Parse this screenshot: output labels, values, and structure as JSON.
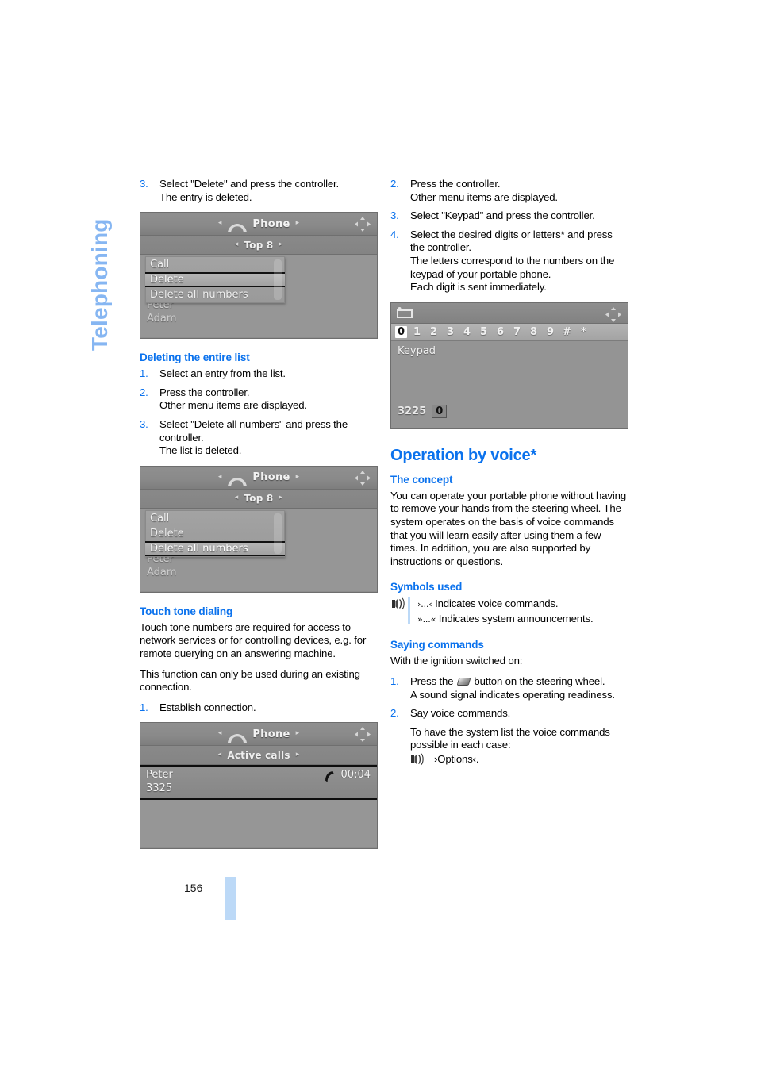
{
  "side_tab": {
    "label": "Telephoning",
    "color": "#86b6f2"
  },
  "folio": {
    "page_number": "156"
  },
  "colors": {
    "heading_blue": "#0b72ed",
    "tab_blue": "#86b6f2",
    "accent_bar": "#bcd9f7"
  },
  "left_column": {
    "step3_delete": {
      "num": "3.",
      "line1": "Select \"Delete\" and press the controller.",
      "line2": "The entry is deleted."
    },
    "screen_delete": {
      "header_title": "Phone",
      "subheader": "Top 8",
      "arrow_left": "◂",
      "arrow_right": "▸",
      "menu_items": [
        "Call",
        "Delete",
        "Delete all numbers"
      ],
      "selected_item": "Delete",
      "background_entries": [
        "Peter",
        "Adam"
      ]
    },
    "deleting_entire_list": {
      "heading": "Deleting the entire list",
      "steps": [
        {
          "num": "1.",
          "line1": "Select an entry from the list.",
          "line2": ""
        },
        {
          "num": "2.",
          "line1": "Press the controller.",
          "line2": "Other menu items are displayed."
        },
        {
          "num": "3.",
          "line1": "Select \"Delete all numbers\" and press the controller.",
          "line2": "The list is deleted."
        }
      ]
    },
    "screen_delete_all": {
      "header_title": "Phone",
      "subheader": "Top 8",
      "menu_items": [
        "Call",
        "Delete",
        "Delete all numbers"
      ],
      "selected_item": "Delete all numbers",
      "background_entries": [
        "Peter",
        "Adam"
      ]
    },
    "touch_tone": {
      "heading": "Touch tone dialing",
      "para1": "Touch tone numbers are required for access to network services or for controlling devices, e.g. for remote querying on an answering machine.",
      "para2": "This function can only be used during an existing connection.",
      "step1": {
        "num": "1.",
        "line1": "Establish connection."
      }
    },
    "screen_active_call": {
      "header_title": "Phone",
      "subheader": "Active calls",
      "caller_name": "Peter",
      "caller_number": "3325",
      "duration": "00:04"
    }
  },
  "right_column": {
    "steps_keypad": [
      {
        "num": "2.",
        "line1": "Press the controller.",
        "line2": "Other menu items are displayed."
      },
      {
        "num": "3.",
        "line1": "Select \"Keypad\" and press the controller.",
        "line2": ""
      },
      {
        "num": "4.",
        "line1": "Select the desired digits or letters* and press the controller.",
        "line2": "The letters correspond to the numbers on the keypad of your portable phone.",
        "line3": "Each digit is sent immediately."
      }
    ],
    "screen_keypad": {
      "keys": [
        "0",
        "1",
        "2",
        "3",
        "4",
        "5",
        "6",
        "7",
        "8",
        "9",
        "#",
        "*"
      ],
      "selected_key": "0",
      "label": "Keypad",
      "entry": "3225",
      "entry_cursor": "0"
    },
    "operation_by_voice": {
      "heading": "Operation by voice*",
      "concept_heading": "The concept",
      "concept_text": "You can operate your portable phone without having to remove your hands from the steering wheel. The system operates on the basis of voice commands that you will learn easily after using them a few times. In addition, you are also supported by instructions or questions.",
      "symbols_heading": "Symbols used",
      "symbol_voice_commands": {
        "marks": "›...‹",
        "text": "Indicates voice commands."
      },
      "symbol_system_announcements": {
        "marks": "»...«",
        "text": "Indicates system announcements."
      },
      "saying_heading": "Saying commands",
      "saying_intro": "With the ignition switched on:",
      "saying_steps": [
        {
          "num": "1.",
          "pre": "Press the",
          "post": "button on the steering wheel.",
          "line2": "A sound signal indicates operating readiness."
        },
        {
          "num": "2.",
          "line1": "Say voice commands.",
          "line2": "To have the system list the voice commands possible in each case:"
        }
      ],
      "options_command": "›Options‹."
    }
  }
}
